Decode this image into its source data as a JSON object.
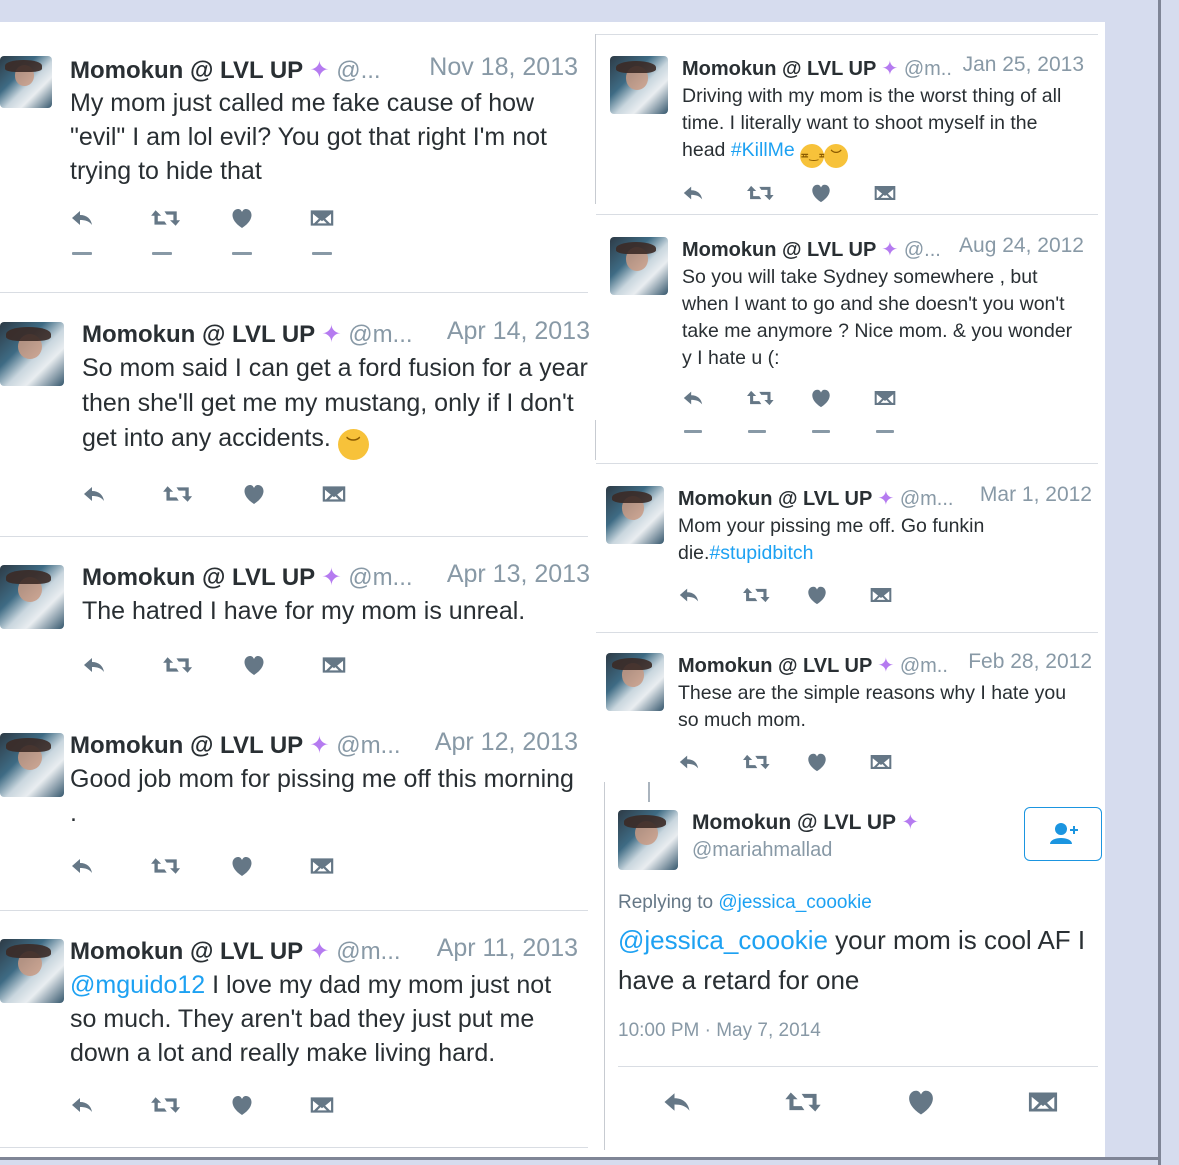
{
  "left_tweets": [
    {
      "name": "Momokun @ LVL UP",
      "handle": "@...",
      "date": "Nov 18, 2013",
      "text": "My mom just called me fake cause of how \"evil\" I am lol evil? You got that right I'm not trying to hide that"
    },
    {
      "name": "Momokun @ LVL UP",
      "handle": "@m...",
      "date": "Apr 14, 2013",
      "text": "So mom said I can get a ford fusion for a year then she'll get me my mustang, only if I don't get into any accidents.",
      "emoji": "disappointed-face"
    },
    {
      "name": "Momokun @ LVL UP",
      "handle": "@m...",
      "date": "Apr 13, 2013",
      "text": "The hatred I have for my mom is unreal."
    },
    {
      "name": "Momokun @ LVL UP",
      "handle": "@m...",
      "date": "Apr 12, 2013",
      "text": "Good job mom for pissing me off this morning ."
    },
    {
      "name": "Momokun @ LVL UP",
      "handle": "@m...",
      "date": "Apr 11, 2013",
      "mention": "@mguido12",
      "text": " I love my dad my mom just not so much. They aren't bad they just put me down a lot and really make living hard."
    }
  ],
  "right_tweets": [
    {
      "name": "Momokun @ LVL UP",
      "handle": "@m..",
      "date": "Jan 25, 2013",
      "text": "Driving with my mom is the worst thing of all time. I literally want to shoot myself in the head ",
      "hashtag": "#KillMe",
      "emojis": [
        "unamused-face",
        "disappointed-face"
      ]
    },
    {
      "name": "Momokun @ LVL UP",
      "handle": "@...",
      "date": "Aug 24, 2012",
      "text": "So you will take Sydney somewhere , but when I want to go and she doesn't you won't take me anymore ? Nice mom. & you wonder y I hate u (:"
    },
    {
      "name": "Momokun @ LVL UP",
      "handle": "@m...",
      "date": "Mar 1, 2012",
      "text": "Mom your pissing me off. Go funkin die.",
      "hashtag": "#stupidbitch"
    },
    {
      "name": "Momokun @ LVL UP",
      "handle": "@m..",
      "date": "Feb 28, 2012",
      "text": "These are the simple reasons why I hate you so much mom."
    }
  ],
  "detail_tweet": {
    "name": "Momokun @ LVL UP",
    "handle": "@mariahmallad",
    "replying_prefix": "Replying to ",
    "replying_to": "@jessica_coookie",
    "mention": "@jessica_coookie",
    "text": " your mom is cool AF I have a retard for one",
    "timestamp": "10:00 PM · May 7, 2014",
    "follow_icon": "add-user-icon"
  },
  "icons": {
    "reply": "reply-icon",
    "retweet": "retweet-icon",
    "like": "heart-icon",
    "dm": "envelope-icon",
    "sparkle": "sparkles-emoji"
  },
  "colors": {
    "background": "#d6dcee",
    "link": "#1da1f2",
    "muted": "#8899a6",
    "text": "#292f33",
    "sparkle": "#b57bf0"
  }
}
